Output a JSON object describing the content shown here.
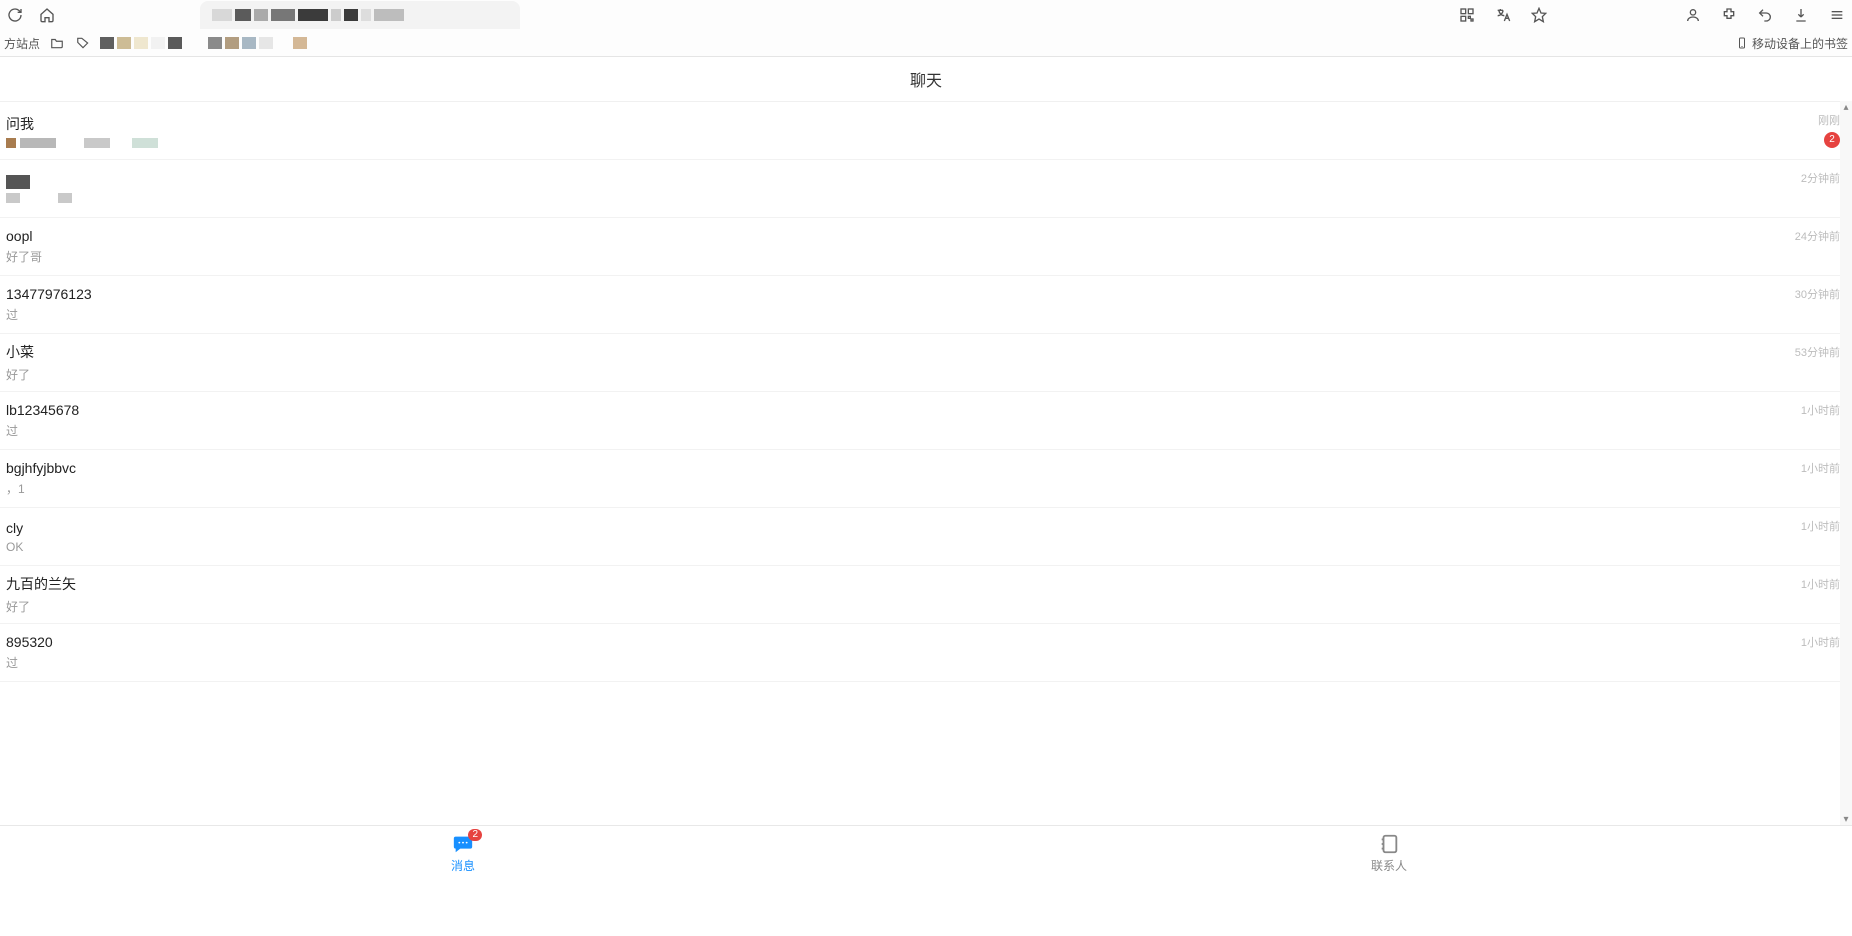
{
  "browser": {
    "bookmarks_left_label": "方站点",
    "mobile_bookmarks": "移动设备上的书签"
  },
  "app": {
    "title": "聊天",
    "bottom_tabs": {
      "messages": "消息",
      "contacts": "联系人",
      "messages_badge": "2"
    },
    "chats": [
      {
        "name": "问我",
        "preview": "",
        "time": "刚刚",
        "badge": "2",
        "pixelated": true
      },
      {
        "name": "",
        "preview": "",
        "time": "2分钟前",
        "badge": "",
        "pixelated_row": true
      },
      {
        "name": "oopl",
        "preview": "好了哥",
        "time": "24分钟前",
        "badge": ""
      },
      {
        "name": "13477976123",
        "preview": "过",
        "time": "30分钟前",
        "badge": ""
      },
      {
        "name": "小菜",
        "preview": "好了",
        "time": "53分钟前",
        "badge": ""
      },
      {
        "name": "lb12345678",
        "preview": "过",
        "time": "1小时前",
        "badge": ""
      },
      {
        "name": "bgjhfyjbbvc",
        "preview": "，1",
        "time": "1小时前",
        "badge": ""
      },
      {
        "name": "cly",
        "preview": "OK",
        "time": "1小时前",
        "badge": ""
      },
      {
        "name": "九百的兰矢",
        "preview": "好了",
        "time": "1小时前",
        "badge": ""
      },
      {
        "name": "895320",
        "preview": "过",
        "time": "1小时前",
        "badge": ""
      }
    ]
  }
}
